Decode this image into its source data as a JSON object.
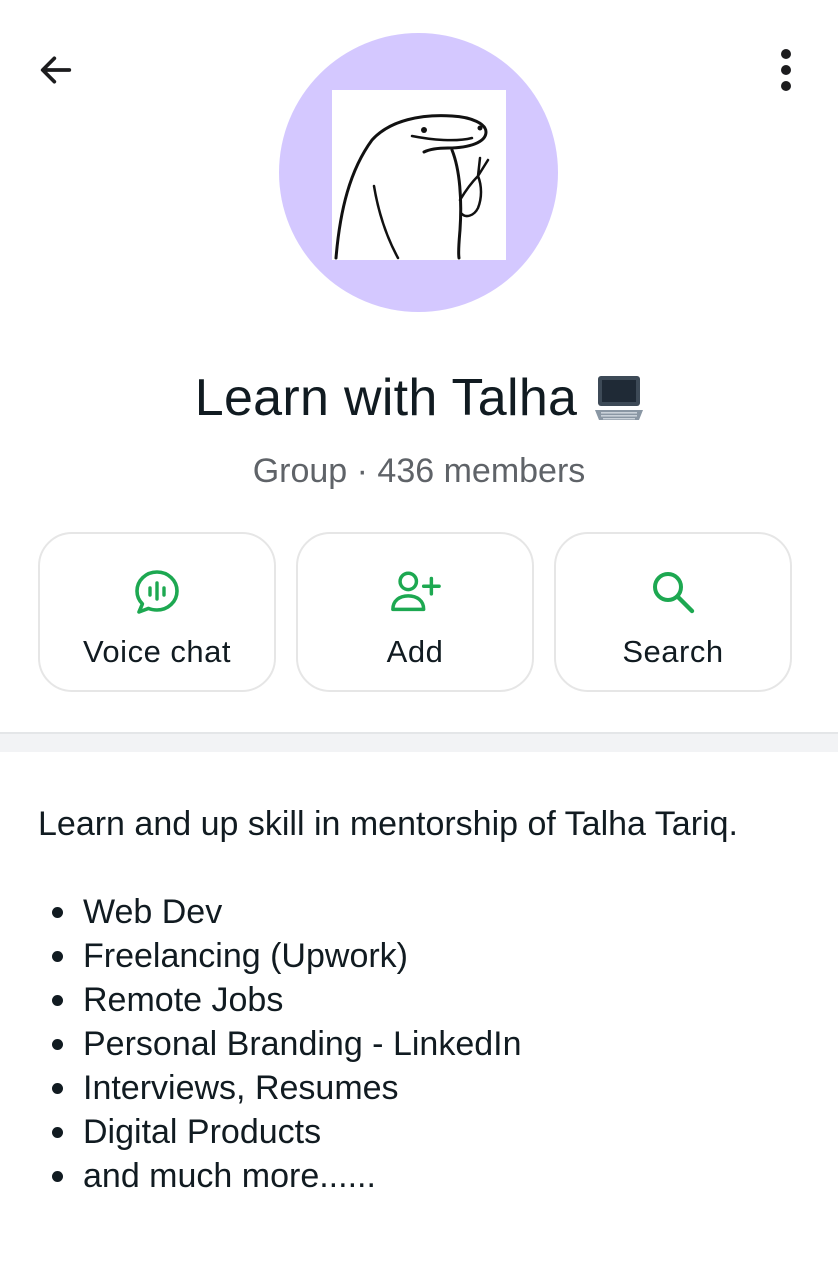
{
  "header": {
    "back_icon": "arrow-left-icon",
    "menu_icon": "more-vertical-icon"
  },
  "profile": {
    "avatar_background": "#d4c8ff",
    "name": "Learn with Talha",
    "name_emoji": "laptop-icon",
    "meta": "Group · 436 members"
  },
  "actions": [
    {
      "label": "Voice chat",
      "icon": "voice-chat-icon"
    },
    {
      "label": "Add",
      "icon": "add-person-icon"
    },
    {
      "label": "Search",
      "icon": "search-icon"
    }
  ],
  "description": {
    "intro": "Learn and up skill in mentorship of Talha Tariq.",
    "items": [
      "Web Dev",
      "Freelancing (Upwork)",
      "Remote Jobs",
      "Personal Branding - LinkedIn",
      "Interviews, Resumes",
      "Digital Products",
      "and much more......"
    ]
  },
  "colors": {
    "accent_green": "#1da851",
    "text_primary": "#111b21",
    "text_secondary": "#5f6368"
  }
}
